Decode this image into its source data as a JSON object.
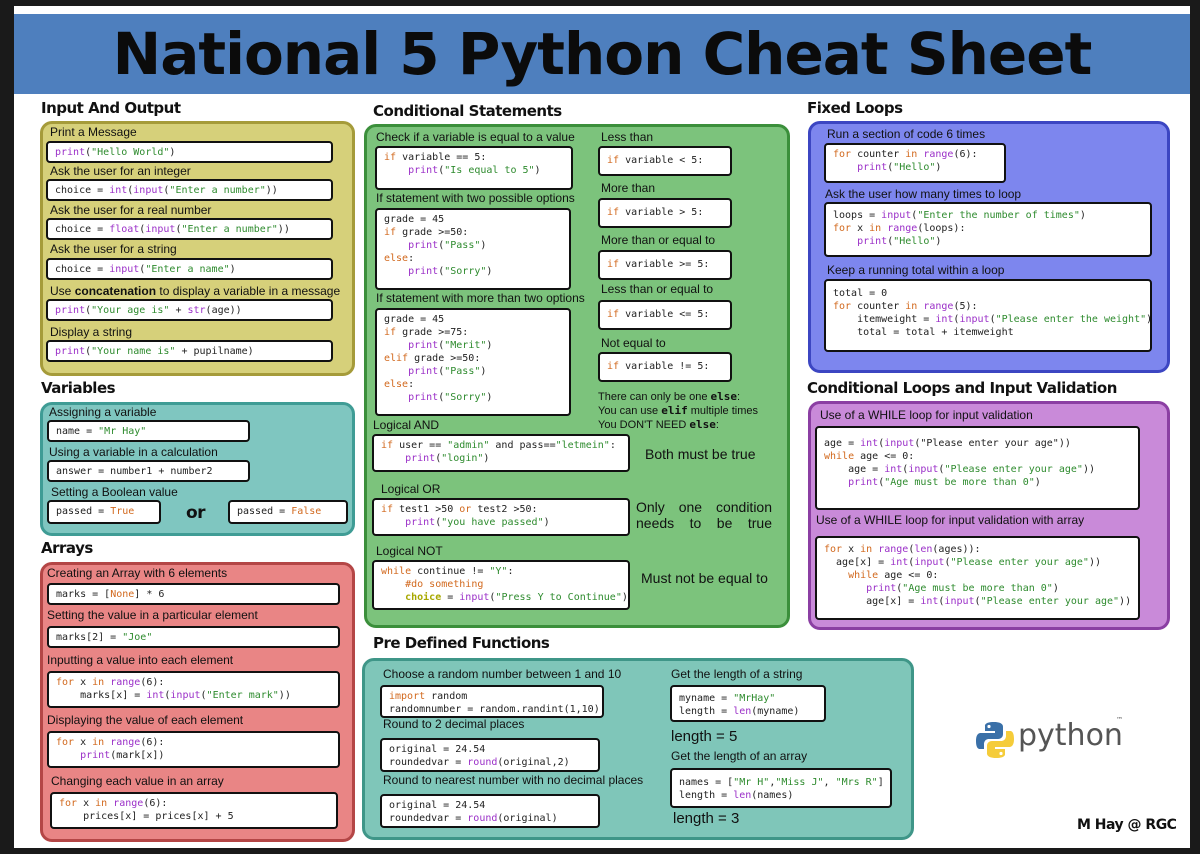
{
  "title": "National 5 Python Cheat Sheet",
  "colors": {
    "banner": "#4e7fbe",
    "io": "#d6d07a",
    "variables": "#7fc6c0",
    "arrays": "#e98585",
    "conditional": "#7cc37c",
    "fixed_loops": "#7d86ee",
    "cond_loops": "#c98ad9",
    "functions": "#7fc6b9",
    "keyword": "#d2691e",
    "builtin": "#9b30c8",
    "string": "#2e8b2e"
  },
  "io": {
    "heading": "Input And Output",
    "items": [
      {
        "label": "Print a Message",
        "code": "print(\"Hello World\")"
      },
      {
        "label": "Ask the user for an integer",
        "code": "choice = int(input(\"Enter a number\"))"
      },
      {
        "label": "Ask the user for a real number",
        "code": "choice = float(input(\"Enter a number\"))"
      },
      {
        "label": "Ask the user for a string",
        "code": "choice = input(\"Enter a name\")"
      },
      {
        "label_pre": "Use ",
        "label_bold": "concatenation",
        "label_post": " to display a variable in a message",
        "code": "print(\"Your age is\" + str(age))"
      },
      {
        "label": "Display a string",
        "code": "print(\"Your name is\" + pupilname)"
      }
    ]
  },
  "variables": {
    "heading": "Variables",
    "assign_label": "Assigning a variable",
    "assign_code": "name = \"Mr Hay\"",
    "calc_label": "Using a variable in a calculation",
    "calc_code": "answer = number1 + number2",
    "bool_label": "Setting a Boolean value",
    "bool_true": "passed = True",
    "or_text": "or",
    "bool_false": "passed = False"
  },
  "arrays": {
    "heading": "Arrays",
    "items": [
      {
        "label": "Creating an Array with 6 elements",
        "code": "marks = [None] * 6"
      },
      {
        "label": "Setting the value in a particular element",
        "code": "marks[2] = \"Joe\""
      },
      {
        "label": "Inputting a value into each element",
        "code": "for x in range(6):\n    marks[x] = int(input(\"Enter mark\"))"
      },
      {
        "label": "Displaying the value of each element",
        "code": "for x in range(6):\n    print(mark[x])"
      },
      {
        "label": "Changing each value in an array",
        "code": "for x in range(6):\n    prices[x] = prices[x] + 5"
      }
    ]
  },
  "conditional": {
    "heading": "Conditional Statements",
    "equal_label": "Check if a variable is equal to a value",
    "equal_code": "if variable == 5:\n    print(\"Is equal to 5\")",
    "two_label": "If statement with two possible options",
    "two_code": "grade = 45\nif grade >=50:\n    print(\"Pass\")\nelse:\n    print(\"Sorry\")",
    "more_label": "If statement with more than two options",
    "more_code": "grade = 45\nif grade >=75:\n    print(\"Merit\")\nelif grade >=50:\n    print(\"Pass\")\nelse:\n    print(\"Sorry\")",
    "comparisons": [
      {
        "label": "Less than",
        "code": "if variable < 5:"
      },
      {
        "label": "More than",
        "code": "if variable > 5:"
      },
      {
        "label": "More than or equal to",
        "code": "if variable >= 5:"
      },
      {
        "label": "Less than or equal to",
        "code": "if variable <= 5:"
      },
      {
        "label": "Not equal to",
        "code": "if variable != 5:"
      }
    ],
    "else_note": {
      "l1_pre": "There can only be one ",
      "l1_code": "else",
      "l1_post": ":",
      "l2_pre": "You can use ",
      "l2_code": "elif",
      "l2_post": " multiple times",
      "l3_pre": "You DON'T NEED ",
      "l3_code": "else",
      "l3_post": ":"
    },
    "and_label": "Logical AND",
    "and_code": "if user == \"admin\" and pass==\"letmein\":\n    print(\"login\")",
    "and_desc": "Both must be true",
    "or_label": "Logical OR",
    "or_code": "if test1 >50 or test2 >50:\n    print(\"you have passed\")",
    "or_desc": "Only one condition needs to be true",
    "not_label": "Logical NOT",
    "not_code": "while continue != \"Y\":\n    #do something\n    choice = input(\"Press Y to Continue\")",
    "not_desc": "Must not be equal to"
  },
  "fixed_loops": {
    "heading": "Fixed Loops",
    "run_label": "Run a section of code 6 times",
    "run_code": "for counter in range(6):\n    print(\"Hello\")",
    "ask_label": "Ask the user how many times to loop",
    "ask_code": "loops = input(\"Enter the number of times\")\nfor x in range(loops):\n    print(\"Hello\")",
    "total_label": "Keep a running total within a loop",
    "total_code": "total = 0\nfor counter in range(5):\n    itemweight = int(input(\"Please enter the weight\"))\n    total = total + itemweight"
  },
  "cond_loops": {
    "heading": "Conditional Loops and Input Validation",
    "while_label": "Use of a WHILE loop for input validation",
    "while_code": "age = int(input(\"Please enter your age\"))\nwhile age <= 0:\n    age = int(input(\"Please enter your age\"))\n    print(\"Age must be more than 0\")",
    "array_label": "Use of a WHILE loop for input validation with array",
    "array_code": "for x in range(len(ages)):\n    age[x] = int(input(\"Please enter your age\"))\n    while age <= 0:\n       print(\"Age must be more than 0\")\n       age[x] = int(input(\"Please enter your age\"))"
  },
  "functions": {
    "heading": "Pre Defined Functions",
    "random_label": "Choose a random number between 1 and 10",
    "random_code": "import random\nrandomnumber = random.randint(1,10)",
    "round2_label": "Round to 2 decimal places",
    "round2_code": "original = 24.54\nroundedvar = round(original,2)",
    "round0_label": "Round to nearest number with no decimal places",
    "round0_code": "original = 24.54\nroundedvar = round(original)",
    "strlen_label": "Get the length of a string",
    "strlen_code": "myname = \"MrHay\"\nlength = len(myname)",
    "strlen_result": "length = 5",
    "arrlen_label": "Get the length of an array",
    "arrlen_code": "names = [\"Mr H\",\"Miss J\", \"Mrs R\"]\nlength = len(names)",
    "arrlen_result": "length = 3"
  },
  "logo_text": "python",
  "logo_tm": "™",
  "credit": "M Hay @ RGC"
}
